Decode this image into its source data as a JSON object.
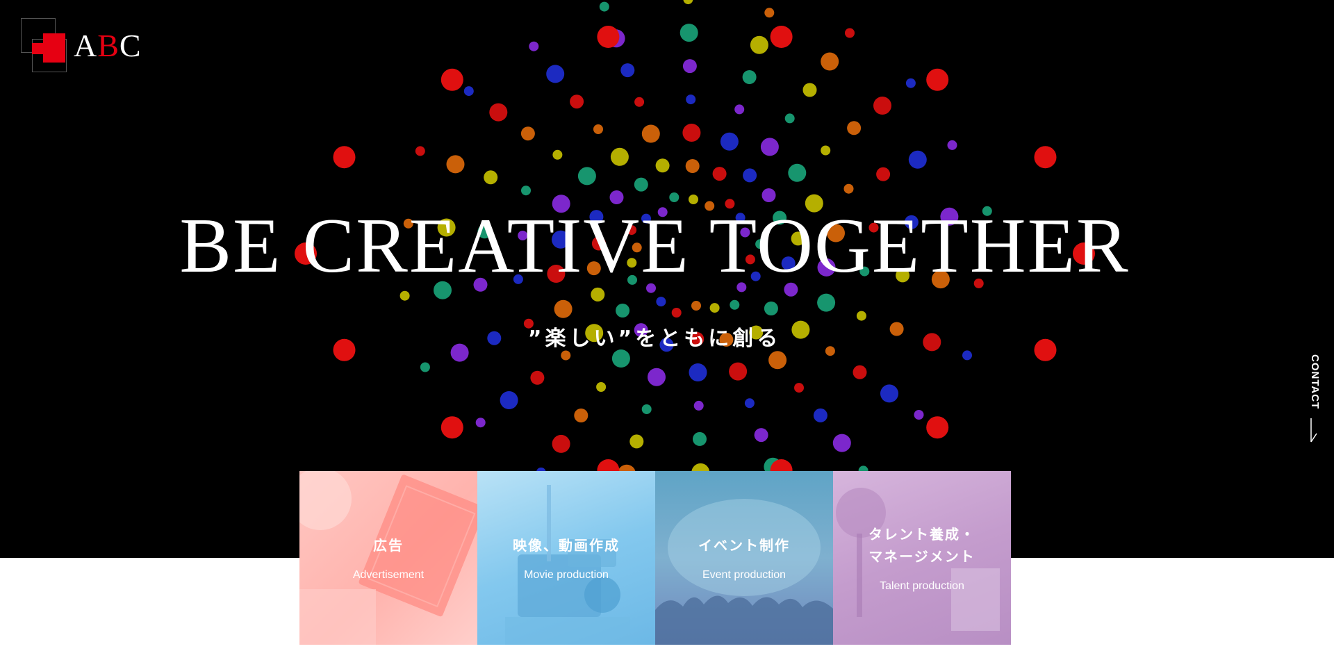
{
  "brand": {
    "logo_text_a": "A",
    "logo_text_b": "B",
    "logo_text_c": "C",
    "accent_color": "#e60012"
  },
  "hero": {
    "headline": "BE CREATIVE TOGETHER",
    "tagline": "”楽しい”をともに創る",
    "background_color": "#000000",
    "dot_colors": [
      "#e01010",
      "#1f2fd6",
      "#8a2be2",
      "#19a57a",
      "#c9c200",
      "#e06a0a"
    ]
  },
  "contact": {
    "label": "CONTACT"
  },
  "services": [
    {
      "title_jp": "広告",
      "title_en": "Advertisement",
      "color": "#ffbdb8"
    },
    {
      "title_jp": "映像、動画作成",
      "title_en": "Movie production",
      "color": "#8cccf0"
    },
    {
      "title_jp": "イベント制作",
      "title_en": "Event production",
      "color": "#6ea6ca"
    },
    {
      "title_jp": "タレント養成・\nマネージメント",
      "title_en": "Talent production",
      "color": "#c6a0cf"
    }
  ]
}
